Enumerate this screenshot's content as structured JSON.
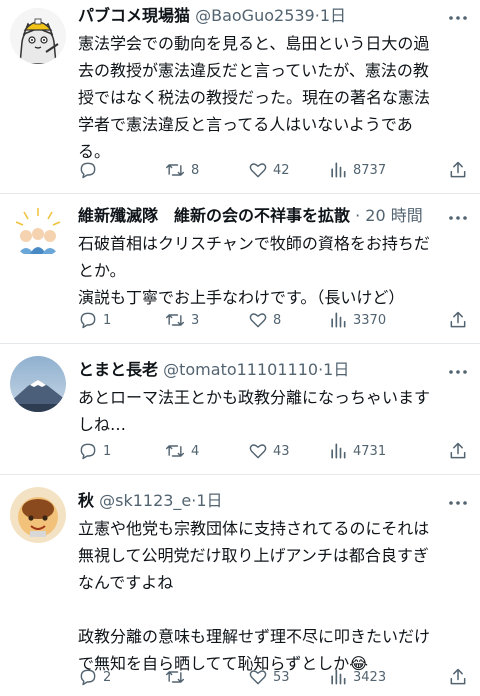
{
  "posts": [
    {
      "name": "パブコメ現場猫",
      "handle": "@BaoGuo2539",
      "time": "1日",
      "lines": [
        "憲法学会での動向を見ると、島田という日大の過",
        "去の教授が憲法違反だと言っていたが、憲法の教",
        "授ではなく税法の教授だった。現在の著名な憲法",
        "学者で憲法違反と言ってる人はいないようであ",
        "る。"
      ],
      "replies": "",
      "reposts": "8",
      "likes": "42",
      "views": "8737"
    },
    {
      "name": "維新殲滅隊　維新の会の不祥事を拡散",
      "handle": "",
      "time": "20 時間",
      "lines": [
        "石破首相はクリスチャンで牧師の資格をお持ちだ",
        "とか。",
        "演説も丁寧でお上手なわけです。（長いけど）"
      ],
      "replies": "1",
      "reposts": "3",
      "likes": "8",
      "views": "3370"
    },
    {
      "name": "とまと長老",
      "handle": "@tomato11101110",
      "time": "1日",
      "lines": [
        "あとローマ法王とかも政教分離になっちゃいます",
        "しね…"
      ],
      "replies": "1",
      "reposts": "4",
      "likes": "43",
      "views": "4731"
    },
    {
      "name": "秋",
      "handle": "@sk1123_e",
      "time": "1日",
      "lines": [
        "立憲や他党も宗教団体に支持されてるのにそれは",
        "無視して公明党だけ取り上げアンチは都合良すぎ",
        "なんですよね",
        "",
        "政教分離の意味も理解せず理不尽に叩きたいだけ",
        "で無知を自ら晒してて恥知らずとしか😂"
      ],
      "replies": "2",
      "reposts": "",
      "likes": "53",
      "views": "3423"
    }
  ]
}
